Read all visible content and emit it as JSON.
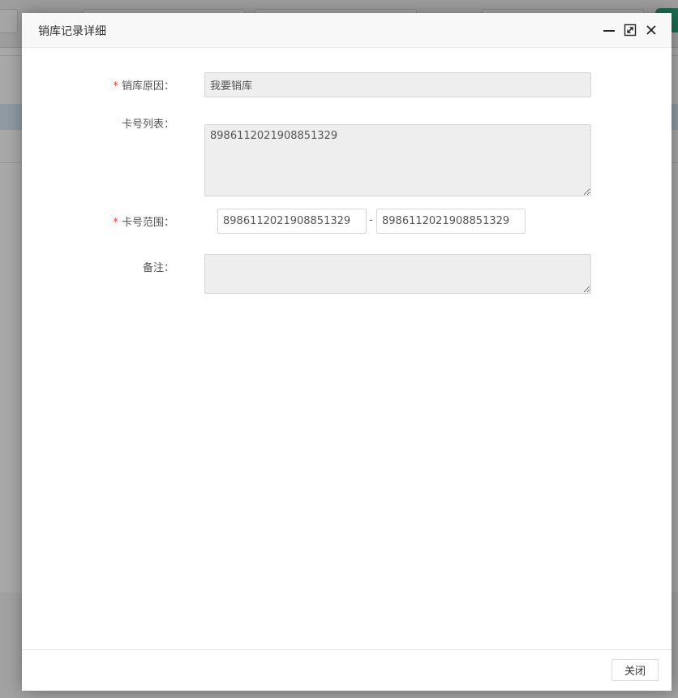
{
  "dialog": {
    "title": "销库记录详细"
  },
  "form": {
    "reason": {
      "label": "销库原因：",
      "required_mark": "*",
      "value": "我要销库"
    },
    "card_list": {
      "label": "卡号列表：",
      "value": "8986112021908851329"
    },
    "card_range": {
      "label": "卡号范围：",
      "required_mark": "*",
      "start": "8986112021908851329",
      "separator": "-",
      "end": "8986112021908851329"
    },
    "remark": {
      "label": "备注：",
      "value": ""
    }
  },
  "footer": {
    "close_label": "关闭"
  },
  "colors": {
    "required": "#e53935",
    "field_bg": "#eeeeee",
    "header_bg": "#f8f8f8",
    "overlay": "#a9a9a9"
  },
  "icons": {
    "minimize": "minimize-icon",
    "maximize": "maximize-icon",
    "close": "close-icon"
  }
}
